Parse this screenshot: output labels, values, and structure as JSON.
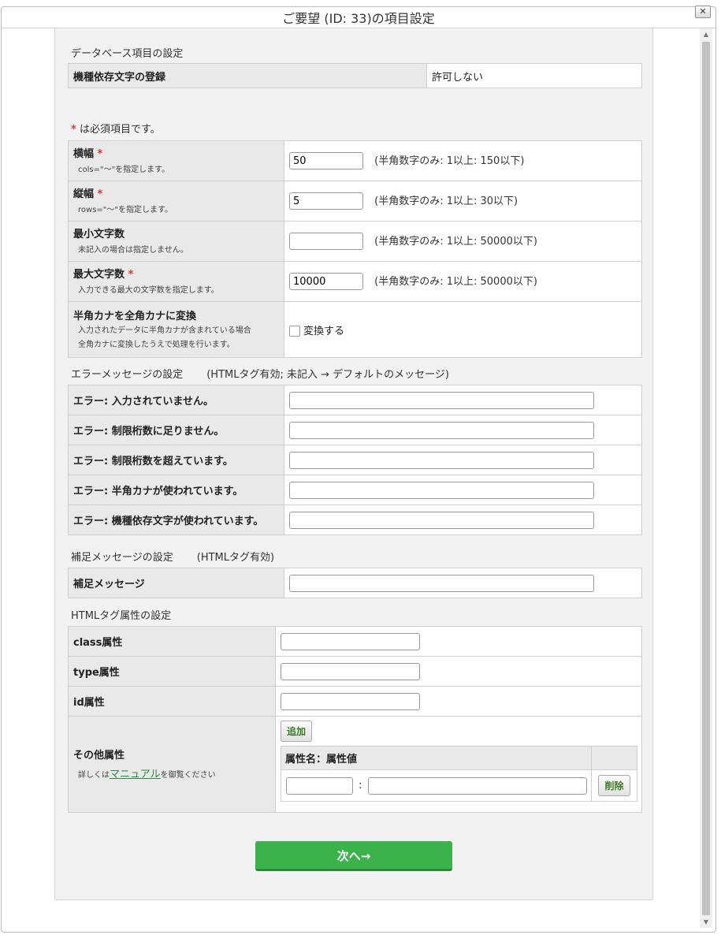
{
  "dialog": {
    "title": "ご要望 (ID: 33)の項目設定",
    "close_label": "✕"
  },
  "db": {
    "section_title": "データベース項目の設定",
    "label": "機種依存文字の登録",
    "value": "許可しない"
  },
  "required_note": {
    "mark": "*",
    "text": "は必須項目です。"
  },
  "size": {
    "rows": [
      {
        "label": "横幅",
        "required": true,
        "desc": "cols=\"〜\"を指定します。",
        "value": "50",
        "hint": "(半角数字のみ: 1以上: 150以下)"
      },
      {
        "label": "縦幅",
        "required": true,
        "desc": "rows=\"〜\"を指定します。",
        "value": "5",
        "hint": "(半角数字のみ: 1以上: 30以下)"
      },
      {
        "label": "最小文字数",
        "required": false,
        "desc": "未記入の場合は指定しません。",
        "value": "",
        "hint": "(半角数字のみ: 1以上: 50000以下)"
      },
      {
        "label": "最大文字数",
        "required": true,
        "desc": "入力できる最大の文字数を指定します。",
        "value": "10000",
        "hint": "(半角数字のみ: 1以上: 50000以下)"
      }
    ],
    "kana": {
      "label": "半角カナを全角カナに変換",
      "desc1": "入力されたデータに半角カナが含まれている場合",
      "desc2": "全角カナに変換したうえで処理を行います。",
      "checkbox_label": "変換する",
      "checked": false
    }
  },
  "errors": {
    "section_title": "エラーメッセージの設定",
    "section_note": "(HTMLタグ有効; 未記入 → デフォルトのメッセージ)",
    "rows": [
      {
        "label": "エラー: 入力されていません。",
        "value": ""
      },
      {
        "label": "エラー: 制限桁数に足りません。",
        "value": ""
      },
      {
        "label": "エラー: 制限桁数を超えています。",
        "value": ""
      },
      {
        "label": "エラー: 半角カナが使われています。",
        "value": ""
      },
      {
        "label": "エラー: 機種依存文字が使われています。",
        "value": ""
      }
    ]
  },
  "supplement": {
    "section_title": "補足メッセージの設定",
    "section_note": "(HTMLタグ有効)",
    "label": "補足メッセージ",
    "value": ""
  },
  "html_attrs": {
    "section_title": "HTMLタグ属性の設定",
    "rows": [
      {
        "label": "class属性",
        "value": ""
      },
      {
        "label": "type属性",
        "value": ""
      },
      {
        "label": "id属性",
        "value": ""
      }
    ],
    "other": {
      "label": "その他属性",
      "desc_prefix": "詳しくは",
      "desc_link": "マニュアル",
      "desc_suffix": "を御覧ください",
      "add_button": "追加",
      "column_header": "属性名：属性値",
      "separator": ":",
      "name_value": "",
      "attr_value": "",
      "delete_button": "削除"
    }
  },
  "next_button": "次へ→"
}
